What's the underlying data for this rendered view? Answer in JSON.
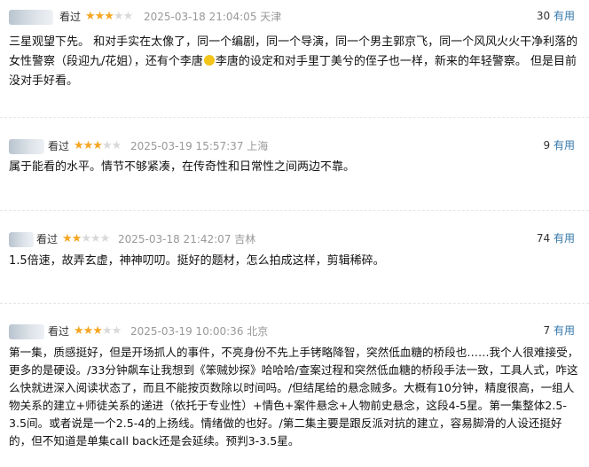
{
  "reviews": [
    {
      "tag": "看过",
      "rating": 3,
      "time": "2025-03-18 21:04:05",
      "location": "天津",
      "useful_count": "30",
      "useful_label": "有用",
      "content_a": "三星观望下先。 和对手实在太像了，同一个编剧，同一个导演，同一个男主郭京飞，同一个风风火火干净利落的女性警察（段迎九/花姐），还有个李唐",
      "emoji": "grinning-face-emoji",
      "content_b": "李唐的设定和对手里丁美兮的侄子也一样，新来的年轻警察。 但是目前没对手好看。"
    },
    {
      "tag": "看过",
      "rating": 3,
      "time": "2025-03-19 15:57:37",
      "location": "上海",
      "useful_count": "9",
      "useful_label": "有用",
      "content": "属于能看的水平。情节不够紧凑，在传奇性和日常性之间两边不靠。"
    },
    {
      "tag": "看过",
      "rating": 2,
      "time": "2025-03-18 21:42:07",
      "location": "吉林",
      "useful_count": "74",
      "useful_label": "有用",
      "content": "1.5倍速，故弄玄虚，神神叨叨。挺好的题材，怎么拍成这样，剪辑稀碎。"
    },
    {
      "tag": "看过",
      "rating": 3,
      "time": "2025-03-19 10:00:36",
      "location": "北京",
      "useful_count": "7",
      "useful_label": "有用",
      "content": "第一集，质感挺好，但是开场抓人的事件，不亮身份不先上手铐略降智，突然低血糖的桥段也……我个人很难接受，更多的是硬设。/33分钟飙车让我想到《笨贼妙探》哈哈哈/查案过程和突然低血糖的桥段手法一致，工具人式，咋这么快就进深入阅读状态了，而且不能按页数除以时间吗。/但结尾给的悬念贼多。大概有10分钟，精度很高，一组人物关系的建立+师徒关系的递进（依托于专业性）+情色+案件悬念+人物前史悬念，这段4-5星。第一集整体2.5-3.5间。或者说是一个2.5-4的上扬线。情绪做的也好。/第二集主要是跟反派对抗的建立，容易脚滑的人设还挺好的，但不知道是单集call back还是会延续。预判3-3.5星。"
    }
  ],
  "colors": {
    "star_on": "#f5a623",
    "star_off": "#d9d9d9",
    "useful_label": "#3377aa",
    "time": "#999999"
  }
}
